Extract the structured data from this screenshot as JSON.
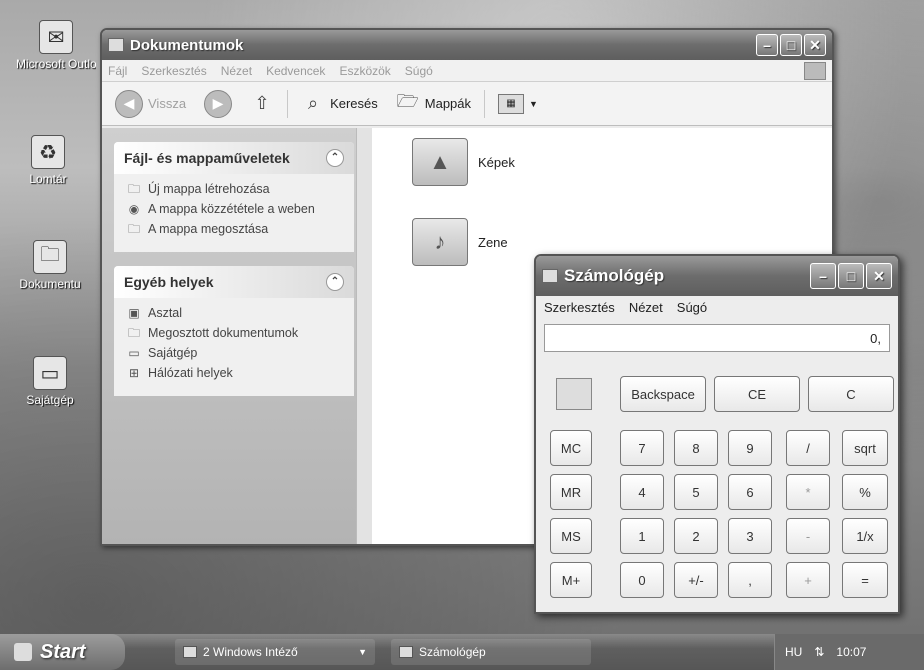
{
  "desktop": {
    "icons": [
      {
        "label": "Microsoft Outlook",
        "icon": "outlook-icon"
      },
      {
        "label": "Lomtár",
        "icon": "recycle-bin-icon"
      },
      {
        "label": "Dokumentu",
        "icon": "documents-folder-icon"
      },
      {
        "label": "Sajátgép",
        "icon": "my-computer-icon"
      }
    ]
  },
  "explorer": {
    "title": "Dokumentumok",
    "menu": [
      "Fájl",
      "Szerkesztés",
      "Nézet",
      "Kedvencek",
      "Eszközök",
      "Súgó"
    ],
    "toolbar": {
      "back": "Vissza",
      "search": "Keresés",
      "folders": "Mappák"
    },
    "tasks_panel": {
      "title": "Fájl- és mappaműveletek",
      "items": [
        "Új mappa létrehozása",
        "A mappa közzététele a weben",
        "A mappa megosztása"
      ]
    },
    "places_panel": {
      "title": "Egyéb helyek",
      "items": [
        "Asztal",
        "Megosztott dokumentumok",
        "Sajátgép",
        "Hálózati helyek"
      ]
    },
    "folders": [
      {
        "name": "Képek"
      },
      {
        "name": "Zene"
      }
    ]
  },
  "calculator": {
    "title": "Számológép",
    "menu": [
      "Szerkesztés",
      "Nézet",
      "Súgó"
    ],
    "display": "0,",
    "top_buttons": [
      "Backspace",
      "CE",
      "C"
    ],
    "rows": [
      [
        "MC",
        "7",
        "8",
        "9",
        "/",
        "sqrt"
      ],
      [
        "MR",
        "4",
        "5",
        "6",
        "*",
        "%"
      ],
      [
        "MS",
        "1",
        "2",
        "3",
        "-",
        "1/x"
      ],
      [
        "M+",
        "0",
        "+/-",
        ",",
        "+",
        "="
      ]
    ]
  },
  "taskbar": {
    "start_label": "Start",
    "items": [
      "2 Windows Intéző",
      "Számológép"
    ],
    "language": "HU",
    "clock": "10:07"
  }
}
